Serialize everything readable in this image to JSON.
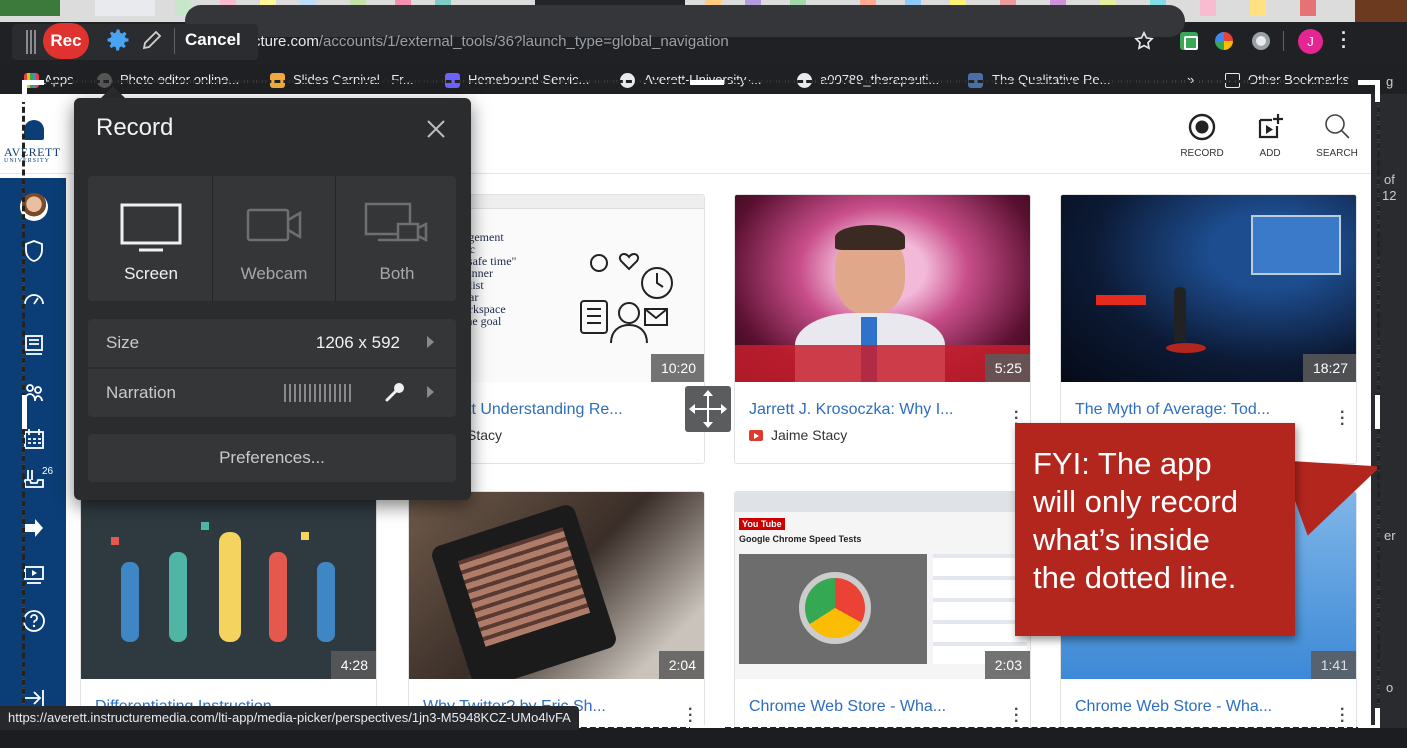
{
  "toolbar": {
    "rec_label": "Rec",
    "cancel_label": "Cancel"
  },
  "browser": {
    "url_visible": "cture.com",
    "url_path": "/accounts/1/external_tools/36?launch_type=global_navigation",
    "avatar_letter": "J"
  },
  "bookmarks": [
    {
      "label": "Apps"
    },
    {
      "label": "Photo editor online..."
    },
    {
      "label": "Slides Carnival - Fr..."
    },
    {
      "label": "Homebound Servic..."
    },
    {
      "label": "Averett-University-..."
    },
    {
      "label": "a00789_therapeuti..."
    },
    {
      "label": "The Qualitative Re..."
    },
    {
      "label": "»"
    },
    {
      "label": "Other Bookmarks"
    }
  ],
  "logo": {
    "text": "AVERETT",
    "sub": "UNIVERSITY"
  },
  "header_actions": [
    {
      "label": "RECORD",
      "icon": "record-icon"
    },
    {
      "label": "ADD",
      "icon": "add-media-icon"
    },
    {
      "label": "SEARCH",
      "icon": "search-icon"
    }
  ],
  "nav": {
    "inbox_badge": "26"
  },
  "record_panel": {
    "title": "Record",
    "modes": [
      {
        "label": "Screen",
        "selected": true
      },
      {
        "label": "Webcam",
        "selected": false
      },
      {
        "label": "Both",
        "selected": false
      }
    ],
    "size_label": "Size",
    "size_value": "1206 x 592",
    "narration_label": "Narration",
    "preferences_label": "Preferences..."
  },
  "cards": [
    {
      "title": "tt Understanding Re...",
      "owner": "Stacy",
      "duration": "10:20",
      "slide_text": "agement\ntic\n\"safe time\"\nlanner\ndlist\ndar\norkspace\nthe goal"
    },
    {
      "title": "Jarrett J. Krosoczka: Why I...",
      "owner": "Jaime Stacy",
      "duration": "5:25"
    },
    {
      "title": "The Myth of Average: Tod...",
      "owner": "",
      "duration": "18:27"
    },
    {
      "title": "Differentiating Instruction...",
      "owner": "",
      "duration": "4:28"
    },
    {
      "title": "Why Twitter? by Eric Sh...",
      "owner": "",
      "duration": "2:04"
    },
    {
      "title": "Chrome Web Store - Wha...",
      "owner": "",
      "duration": "2:03"
    },
    {
      "title": "Chrome Web Store - Wha...",
      "owner": "",
      "duration": "1:41"
    }
  ],
  "youtube_thumb": {
    "heading": "Google Chrome Speed Tests",
    "logo": "You Tube"
  },
  "callout": {
    "text": "FYI: The app\nwill only record\nwhat’s inside\nthe dotted line."
  },
  "status_url": "https://averett.instructuremedia.com/lti-app/media-picker/perspectives/1jn3-M5948KCZ-UMo4lvFA",
  "right_fragments": {
    "a": "of",
    "b": "12",
    "c": "g",
    "d": "er",
    "e": "o"
  },
  "colors": {
    "rec_red": "#e0332f",
    "callout_red": "#b3261e",
    "nav_blue": "#0b3e76",
    "link_blue": "#2d6ebf"
  }
}
